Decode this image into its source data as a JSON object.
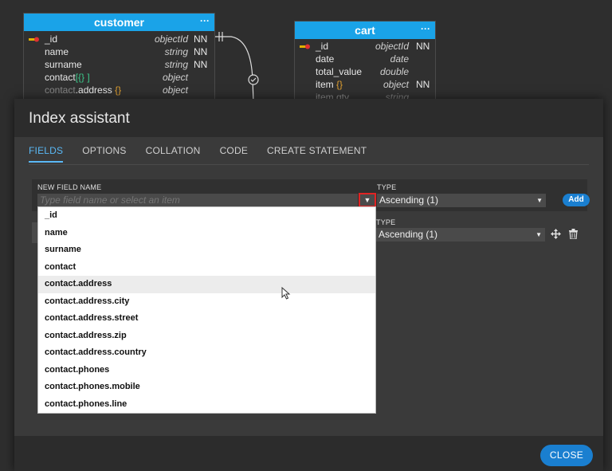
{
  "diagram": {
    "customer": {
      "title": "customer",
      "menu_icon": "more-dots-icon",
      "fields": [
        {
          "name": "_id",
          "type": "objectId",
          "nn": "NN",
          "key": true
        },
        {
          "name": "name",
          "type": "string",
          "nn": "NN"
        },
        {
          "name": "surname",
          "type": "string",
          "nn": "NN"
        },
        {
          "name_prefix": "contact",
          "name_suffix": "[{} ]",
          "type": "object",
          "nn": ""
        },
        {
          "name_prefix": "contact",
          "name_mid": ".address ",
          "name_suffix": "{}",
          "type": "object",
          "nn": ""
        }
      ]
    },
    "cart": {
      "title": "cart",
      "menu_icon": "more-dots-icon",
      "fields": [
        {
          "name": "_id",
          "type": "objectId",
          "nn": "NN",
          "key": true
        },
        {
          "name": "date",
          "type": "date",
          "nn": ""
        },
        {
          "name": "total_value",
          "type": "double",
          "nn": ""
        },
        {
          "name": "item ",
          "suffix": "{}",
          "type": "object",
          "nn": "NN"
        },
        {
          "name": "item.qty",
          "type": "string",
          "nn": ""
        }
      ]
    }
  },
  "dialog": {
    "title": "Index assistant",
    "tabs": [
      "FIELDS",
      "OPTIONS",
      "COLLATION",
      "CODE",
      "CREATE STATEMENT"
    ],
    "active_tab": "FIELDS",
    "new_field_label": "NEW FIELD NAME",
    "new_field_placeholder": "Type field name or select an item",
    "type_label": "TYPE",
    "type_value": "Ascending (1)",
    "add_label": "Add",
    "row2_type_label": "TYPE",
    "row2_type_value": "Ascending (1)",
    "close_label": "CLOSE",
    "dropdown_items": [
      "_id",
      "name",
      "surname",
      "contact",
      "contact.address",
      "contact.address.city",
      "contact.address.street",
      "contact.address.zip",
      "contact.address.country",
      "contact.phones",
      "contact.phones.mobile",
      "contact.phones.line"
    ],
    "hovered_item": "contact.address"
  },
  "colors": {
    "accent": "#1aa3e8",
    "button": "#1a7fd0",
    "highlight_border": "#e02424",
    "dialog_bg": "#3a3a3a"
  }
}
